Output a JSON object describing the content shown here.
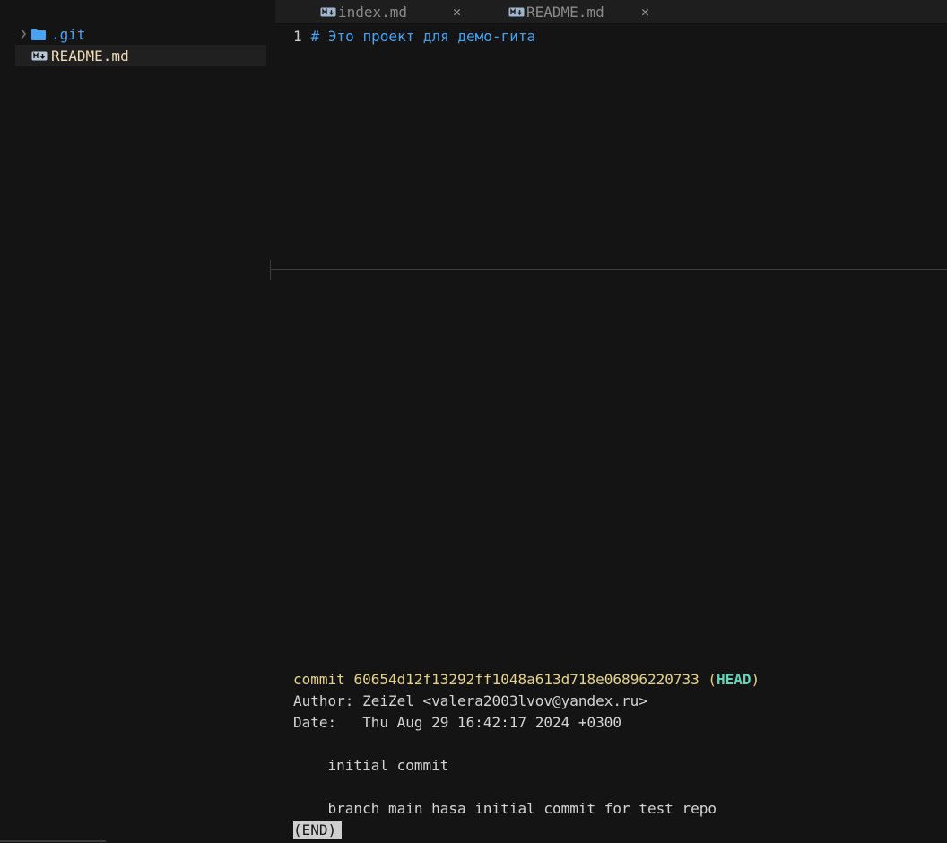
{
  "sidebar": {
    "items": [
      {
        "label": ".git",
        "icon": "folder-icon",
        "expandable": true
      },
      {
        "label": "README.md",
        "icon": "markdown-icon",
        "selected": true
      }
    ]
  },
  "tabs": [
    {
      "label": "index.md",
      "icon": "markdown-icon"
    },
    {
      "label": "README.md",
      "icon": "markdown-icon"
    }
  ],
  "editor": {
    "lines": [
      {
        "number": "1",
        "text": "# Это проект для демо-гита"
      }
    ]
  },
  "terminal": {
    "commit_prefix": "commit ",
    "commit_hash": "60654d12f13292ff1048a613d718e06896220733",
    "ref_open": " (",
    "ref": "HEAD",
    "ref_close": ")",
    "author": "Author: ZeiZel <valera2003lvov@yandex.ru>",
    "date": "Date:   Thu Aug 29 16:42:17 2024 +0300",
    "message": "    initial commit",
    "body": "    branch main hasa initial commit for test repo",
    "pager_end": "(END)"
  },
  "colors": {
    "background": "#141414",
    "accent_blue": "#4aa3f0",
    "commit_yellow": "#e5d38a",
    "head_cyan": "#62d6b6"
  }
}
